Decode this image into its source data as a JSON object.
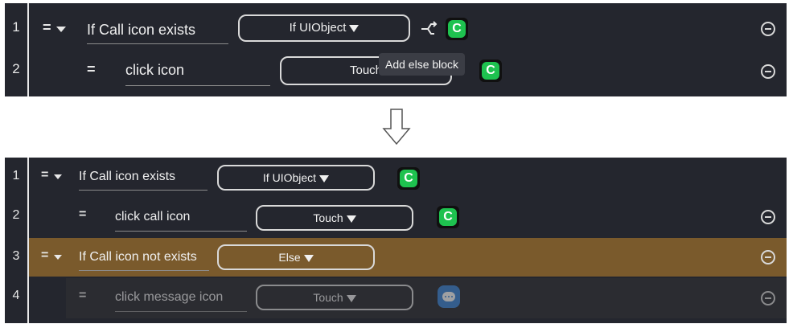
{
  "before": {
    "rows": [
      {
        "line": "1",
        "name": "If Call icon exists",
        "action": "If UIObject"
      },
      {
        "line": "2",
        "name": "click icon",
        "action": "Touch"
      }
    ],
    "tooltip": "Add else block"
  },
  "after": {
    "rows": [
      {
        "line": "1",
        "name": "If Call icon exists",
        "action": "If UIObject"
      },
      {
        "line": "2",
        "name": "click call icon",
        "action": "Touch"
      },
      {
        "line": "3",
        "name": "If Call icon not exists",
        "action": "Else"
      },
      {
        "line": "4",
        "name": "click message icon",
        "action": "Touch"
      }
    ]
  },
  "icons": {
    "drag": "drag-handle-icon",
    "collapse": "caret-down-icon",
    "phone": "phone-app-icon",
    "message": "message-app-icon",
    "remove": "minus-circle-icon",
    "branch": "branch-icon",
    "arrow": "down-arrow-icon"
  },
  "colors": {
    "panel": "#24262e",
    "else_row": "#7a5a2c",
    "phone": "#1ec24f",
    "message": "#3d86d8"
  }
}
